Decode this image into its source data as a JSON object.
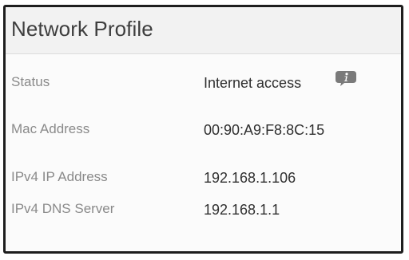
{
  "panel": {
    "title": "Network Profile"
  },
  "rows": [
    {
      "label": "Status",
      "value": "Internet access"
    },
    {
      "label": "Mac Address",
      "value": "00:90:A9:F8:8C:15"
    },
    {
      "label": "IPv4 IP Address",
      "value": "192.168.1.106"
    },
    {
      "label": "IPv4 DNS Server",
      "value": "192.168.1.1"
    }
  ],
  "icons": {
    "info": "info-speech-bubble-icon"
  },
  "colors": {
    "title_bar_bg": "#f2f2f2",
    "label_text": "#8a8a8a",
    "value_text": "#2f2f2f",
    "icon_fill": "#7a7a7a"
  }
}
